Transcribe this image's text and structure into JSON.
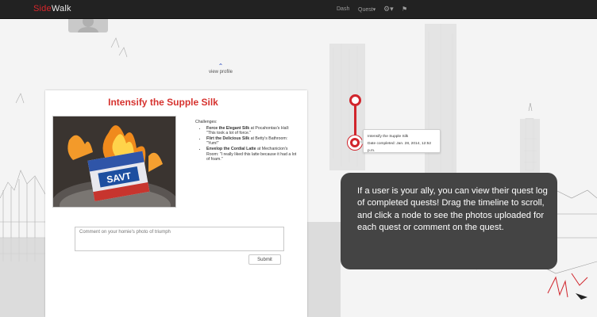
{
  "app": {
    "brand_part1": "Side",
    "brand_part2": "Walk"
  },
  "nav": {
    "dash": "Dash",
    "quest": "Quest▾",
    "gear": "⚙▾",
    "flag": "⚑"
  },
  "profile": {
    "view_label": "view profile"
  },
  "quest": {
    "title": "Intensify the Supple Silk",
    "photo_label": "SAVT",
    "challenges_heading": "Challenges:",
    "challenges": [
      {
        "name": "Force the Elegant Silk",
        "place": " at Pocahontas's Hall:",
        "quote": "\"This took a lot of force.\""
      },
      {
        "name": "Flirt the Delicious Silk",
        "place": " at Betty's Bathroom:",
        "quote": "\"Yum!\""
      },
      {
        "name": "Envelop the Cordial Latte",
        "place": " at Mechanicion's Room:",
        "quote": "\"I really liked this latte because it had a lot of foam.\""
      }
    ],
    "comment_placeholder": "Comment on your homie's photo of triumph",
    "submit_label": "Submit"
  },
  "timeline": {
    "popup_title": "Intensify the Supple Silk",
    "popup_date": "Date completed: Jan. 28, 2014, 12:52 p.m."
  },
  "hint": {
    "text": "If a user is your ally, you can view their quest log of completed quests! Drag the timeline to scroll, and click a node to see the photos uploaded for each quest or comment on the quest."
  },
  "colors": {
    "brand_red": "#d9262b",
    "timeline_red": "#d1252c",
    "navbar": "#222222",
    "hint_bg": "#444444"
  }
}
